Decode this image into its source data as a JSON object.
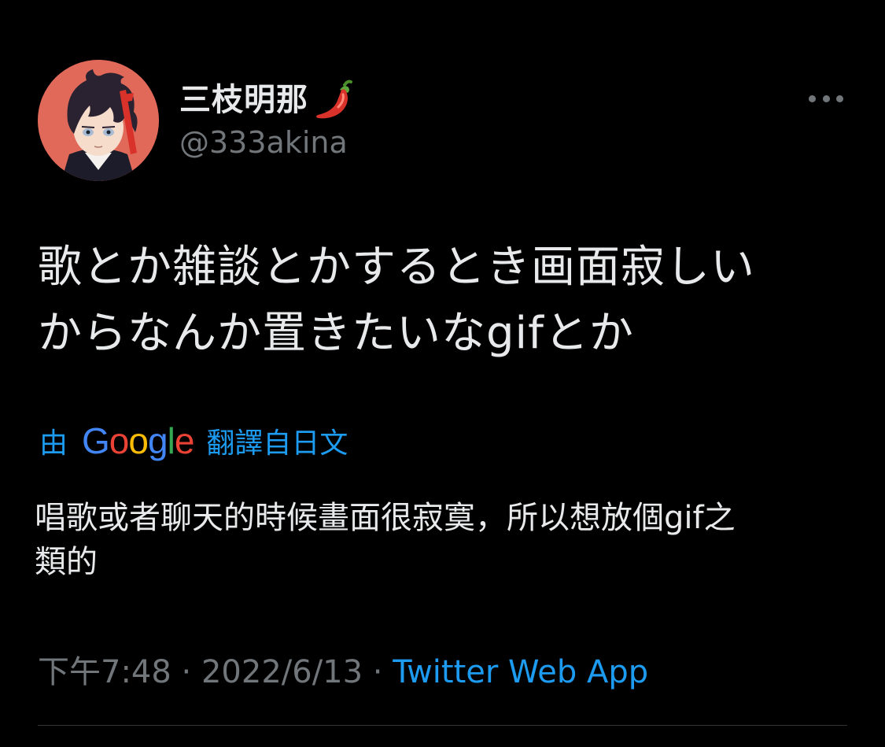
{
  "user": {
    "display_name": "三枝明那",
    "name_emoji": "hot-pepper-icon",
    "handle": "@333akina"
  },
  "menu": {
    "more_icon": "more-horizontal-icon"
  },
  "tweet": {
    "lines": [
      "歌とか雑談とかするとき画面寂しい",
      "からなんか置きたいなgifとか"
    ]
  },
  "translation": {
    "prefix": "由",
    "provider": "Google",
    "suffix": "翻譯自日文",
    "lines": [
      "唱歌或者聊天的時候畫面很寂寞，所以想放個gif之",
      "類的"
    ]
  },
  "meta": {
    "time": "下午7:48",
    "sep1": " · ",
    "date": "2022/6/13",
    "sep2": " · ",
    "source": "Twitter Web App"
  },
  "colors": {
    "background": "#000000",
    "text": "#e7e9ea",
    "secondary": "#71767b",
    "accent": "#1d9bf0",
    "avatar_bg": "#e1695a"
  }
}
